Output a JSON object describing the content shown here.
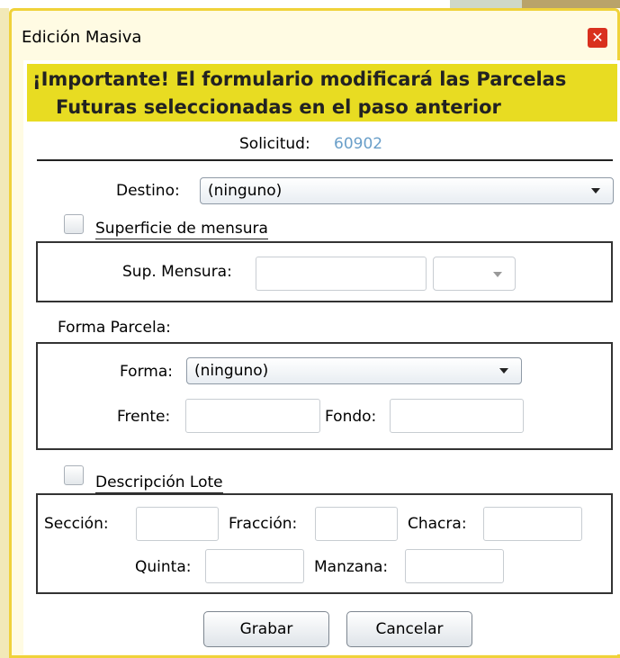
{
  "window": {
    "title": "Edición Masiva",
    "close_icon": "close-icon"
  },
  "banner": {
    "line1": "¡Importante! El formulario modificará las Parcelas",
    "line2": "Futuras seleccionadas en el paso anterior"
  },
  "solicitud": {
    "label": "Solicitud:",
    "value": "60902"
  },
  "destino": {
    "label": "Destino:",
    "selected": "(ninguno)"
  },
  "superficie": {
    "checkbox_label": "Superficie de mensura",
    "checked": false,
    "sup_label": "Sup. Mensura:",
    "sup_value": "",
    "unit_selected": ""
  },
  "forma_parcela": {
    "section_label": "Forma Parcela:",
    "forma_label": "Forma:",
    "forma_selected": "(ninguno)",
    "frente_label": "Frente:",
    "frente_value": "",
    "fondo_label": "Fondo:",
    "fondo_value": ""
  },
  "descripcion_lote": {
    "checkbox_label": "Descripción Lote",
    "checked": false,
    "seccion_label": "Sección:",
    "fraccion_label": "Fracción:",
    "chacra_label": "Chacra:",
    "quinta_label": "Quinta:",
    "manzana_label": "Manzana:"
  },
  "buttons": {
    "save": "Grabar",
    "cancel": "Cancelar"
  },
  "colors": {
    "banner_bg": "#e8dc22",
    "dialog_border": "#f0d23a",
    "close_bg": "#d9301e",
    "solicitud_value": "#6a9fc9"
  }
}
